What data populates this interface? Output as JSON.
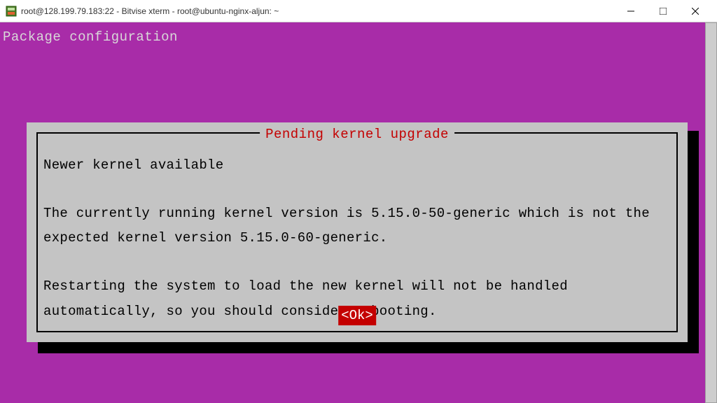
{
  "window": {
    "title": "root@128.199.79.183:22 - Bitvise xterm - root@ubuntu-nginx-aljun: ~"
  },
  "terminal": {
    "header": "Package configuration"
  },
  "dialog": {
    "title": "Pending kernel upgrade",
    "heading": "Newer kernel available",
    "paragraph1": "The currently running kernel version is 5.15.0-50-generic which is not the expected kernel version 5.15.0-60-generic.",
    "paragraph2": "Restarting the system to load the new kernel will not be handled automatically, so you should consider rebooting.",
    "ok_label": "<Ok>"
  }
}
